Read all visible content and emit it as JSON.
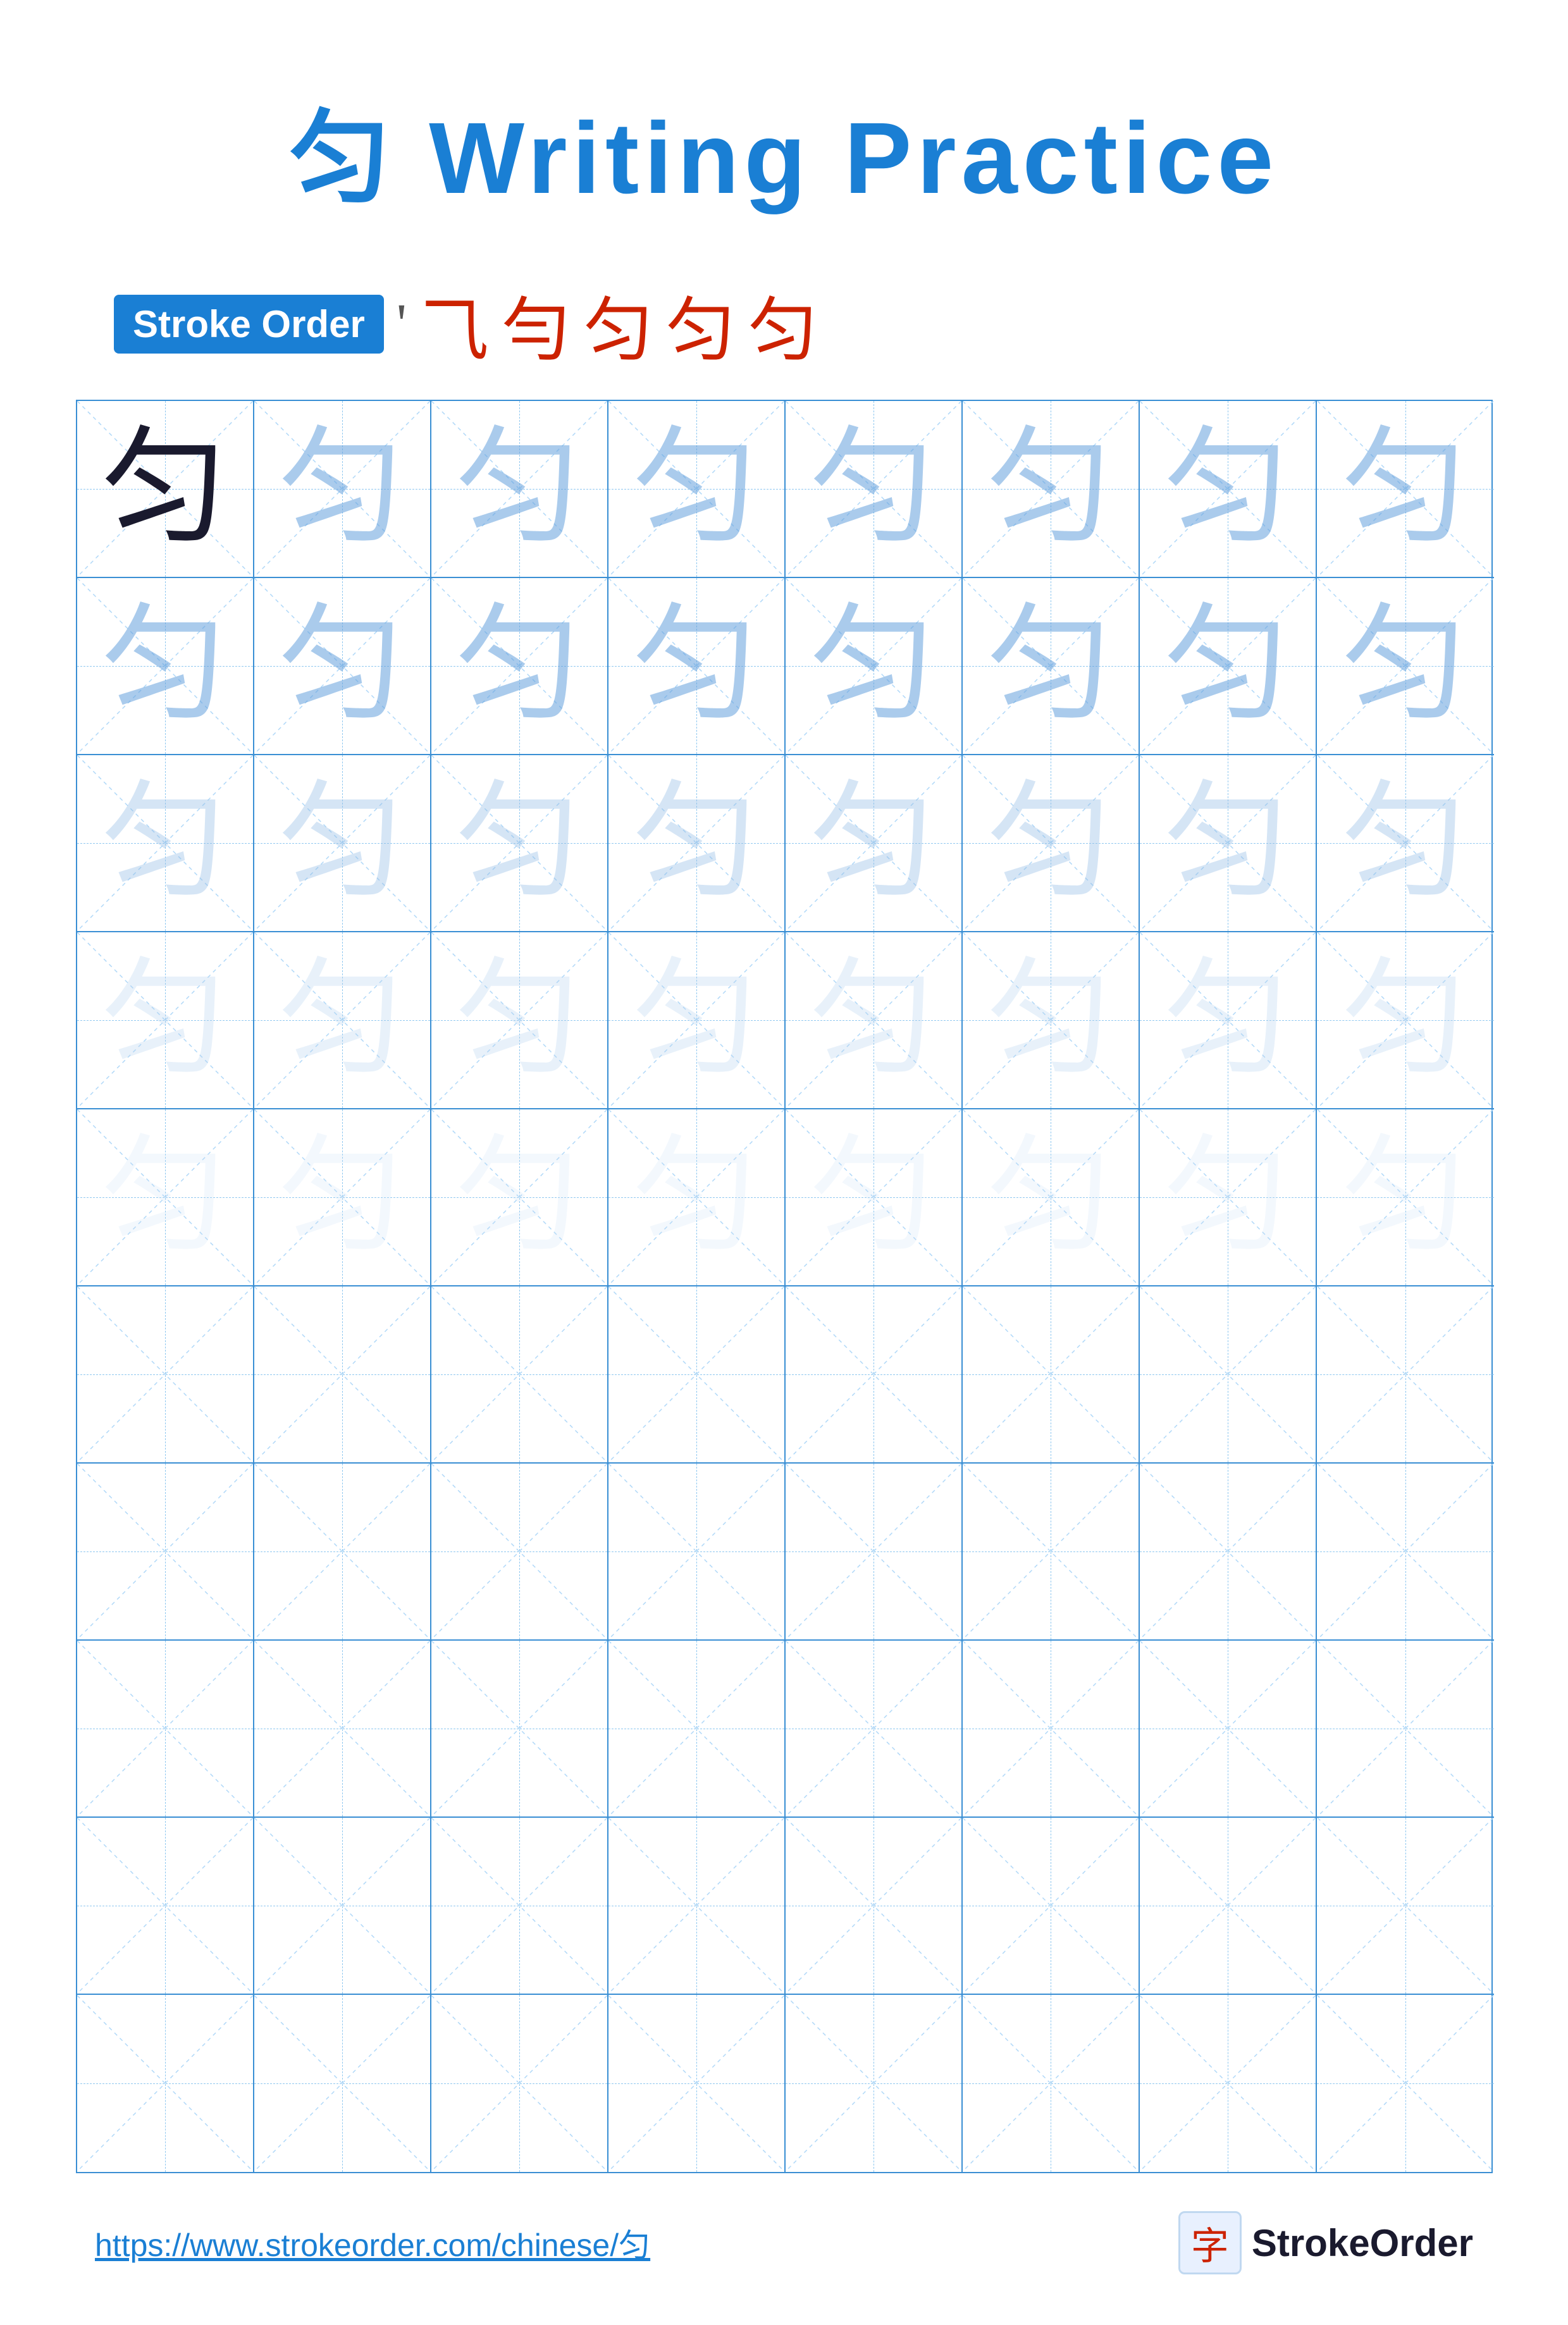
{
  "title": "匀 Writing Practice",
  "stroke_order_badge": "Stroke Order",
  "stroke_order_sequence": [
    "'",
    "⺄",
    "勻",
    "匀",
    "匀",
    "匀"
  ],
  "character": "匀",
  "footer_url": "https://www.strokeorder.com/chinese/匀",
  "footer_logo_char": "字",
  "footer_logo_text": "StrokeOrder",
  "grid": {
    "rows": 10,
    "cols": 8,
    "char_rows": [
      {
        "opacity_class": "char-dark",
        "count": 1
      },
      {
        "opacity_class": "char-light-1",
        "count": 8
      },
      {
        "opacity_class": "char-light-2",
        "count": 8
      },
      {
        "opacity_class": "char-light-3",
        "count": 8
      },
      {
        "opacity_class": "char-light-4",
        "count": 8
      }
    ]
  }
}
